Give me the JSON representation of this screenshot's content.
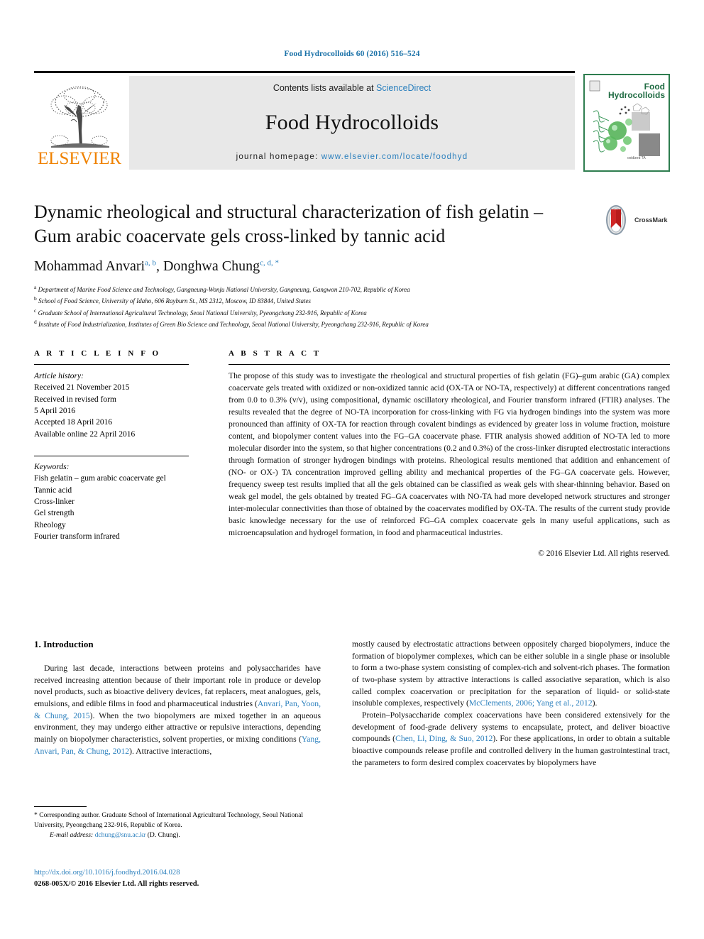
{
  "running_head": "Food Hydrocolloids 60 (2016) 516–524",
  "masthead": {
    "contents_prefix": "Contents lists available at ",
    "contents_link": "ScienceDirect",
    "journal_title": "Food Hydrocolloids",
    "homepage_prefix": "journal homepage: ",
    "homepage_url": "www.elsevier.com/locate/foodhyd",
    "publisher": "ELSEVIER",
    "cover_title_line1": "Food",
    "cover_title_line2": "Hydrocolloids",
    "accent_link_color": "#2a7fbd",
    "publisher_color": "#ef8200",
    "cover_green": "#2e7d4f"
  },
  "crossmark": {
    "label": "CrossMark"
  },
  "article": {
    "title_line1": "Dynamic rheological and structural characterization of fish gelatin –",
    "title_line2": "Gum arabic coacervate gels cross-linked by tannic acid",
    "authors": [
      {
        "name": "Mohammad Anvari",
        "marks": "a, b"
      },
      {
        "name": "Donghwa Chung",
        "marks": "c, d, *"
      }
    ],
    "affiliations": [
      {
        "mark": "a",
        "text": "Department of Marine Food Science and Technology, Gangneung-Wonju National University, Gangneung, Gangwon 210-702, Republic of Korea"
      },
      {
        "mark": "b",
        "text": "School of Food Science, University of Idaho, 606 Rayburn St., MS 2312, Moscow, ID 83844, United States"
      },
      {
        "mark": "c",
        "text": "Graduate School of International Agricultural Technology, Seoul National University, Pyeongchang 232-916, Republic of Korea"
      },
      {
        "mark": "d",
        "text": "Institute of Food Industrialization, Institutes of Green Bio Science and Technology, Seoul National University, Pyeongchang 232-916, Republic of Korea"
      }
    ]
  },
  "article_info": {
    "heading": "A R T I C L E   I N F O",
    "history_label": "Article history:",
    "history": [
      "Received 21 November 2015",
      "Received in revised form",
      "5 April 2016",
      "Accepted 18 April 2016",
      "Available online 22 April 2016"
    ],
    "keywords_label": "Keywords:",
    "keywords": [
      "Fish gelatin – gum arabic coacervate gel",
      "Tannic acid",
      "Cross-linker",
      "Gel strength",
      "Rheology",
      "Fourier transform infrared"
    ]
  },
  "abstract": {
    "heading": "A B S T R A C T",
    "text": "The propose of this study was to investigate the rheological and structural properties of fish gelatin (FG)–gum arabic (GA) complex coacervate gels treated with oxidized or non-oxidized tannic acid (OX-TA or NO-TA, respectively) at different concentrations ranged from 0.0 to 0.3% (v/v), using compositional, dynamic oscillatory rheological, and Fourier transform infrared (FTIR) analyses. The results revealed that the degree of NO-TA incorporation for cross-linking with FG via hydrogen bindings into the system was more pronounced than affinity of OX-TA for reaction through covalent bindings as evidenced by greater loss in volume fraction, moisture content, and biopolymer content values into the FG–GA coacervate phase. FTIR analysis showed addition of NO-TA led to more molecular disorder into the system, so that higher concentrations (0.2 and 0.3%) of the cross-linker disrupted electrostatic interactions through formation of stronger hydrogen bindings with proteins. Rheological results mentioned that addition and enhancement of (NO- or OX-) TA concentration improved gelling ability and mechanical properties of the FG–GA coacervate gels. However, frequency sweep test results implied that all the gels obtained can be classified as weak gels with shear-thinning behavior. Based on weak gel model, the gels obtained by treated FG–GA coacervates with NO-TA had more developed network structures and stronger inter-molecular connectivities than those of obtained by the coacervates modified by OX-TA. The results of the current study provide basic knowledge necessary for the use of reinforced FG–GA complex coacervate gels in many useful applications, such as microencapsulation and hydrogel formation, in food and pharmaceutical industries.",
    "copyright": "© 2016 Elsevier Ltd. All rights reserved."
  },
  "body": {
    "section_heading": "1. Introduction",
    "left_paragraph_1_a": "During last decade, interactions between proteins and polysaccharides have received increasing attention because of their important role in produce or develop novel products, such as bioactive delivery devices, fat replacers, meat analogues, gels, emulsions, and edible films in food and pharmaceutical industries (",
    "left_ref_1": "Anvari, Pan, Yoon, & Chung, 2015",
    "left_paragraph_1_b": "). When the two biopolymers are mixed together in an aqueous environment, they may undergo either attractive or repulsive interactions, depending mainly on biopolymer characteristics, solvent properties, or mixing conditions (",
    "left_ref_2": "Yang, Anvari, Pan, & Chung, 2012",
    "left_paragraph_1_c": "). Attractive interactions,",
    "right_paragraph_1_a": "mostly caused by electrostatic attractions between oppositely charged biopolymers, induce the formation of biopolymer complexes, which can be either soluble in a single phase or insoluble to form a two-phase system consisting of complex-rich and solvent-rich phases. The formation of two-phase system by attractive interactions is called associative separation, which is also called complex coacervation or precipitation for the separation of liquid- or solid-state insoluble complexes, respectively (",
    "right_ref_1": "McClements, 2006; Yang et al., 2012",
    "right_paragraph_1_b": ").",
    "right_paragraph_2_a": "Protein–Polysaccharide complex coacervations have been considered extensively for the development of food-grade delivery systems to encapsulate, protect, and deliver bioactive compounds (",
    "right_ref_2": "Chen, Li, Ding, & Suo, 2012",
    "right_paragraph_2_b": "). For these applications, in order to obtain a suitable bioactive compounds release profile and controlled delivery in the human gastrointestinal tract, the parameters to form desired complex coacervates by biopolymers have"
  },
  "footnotes": {
    "corresponding": "* Corresponding author. Graduate School of International Agricultural Technology, Seoul National University, Pyeongchang 232-916, Republic of Korea.",
    "email_label": "E-mail address:",
    "email": "dchung@snu.ac.kr",
    "email_suffix": "(D. Chung)."
  },
  "footer": {
    "doi": "http://dx.doi.org/10.1016/j.foodhyd.2016.04.028",
    "issn_line": "0268-005X/© 2016 Elsevier Ltd. All rights reserved."
  }
}
